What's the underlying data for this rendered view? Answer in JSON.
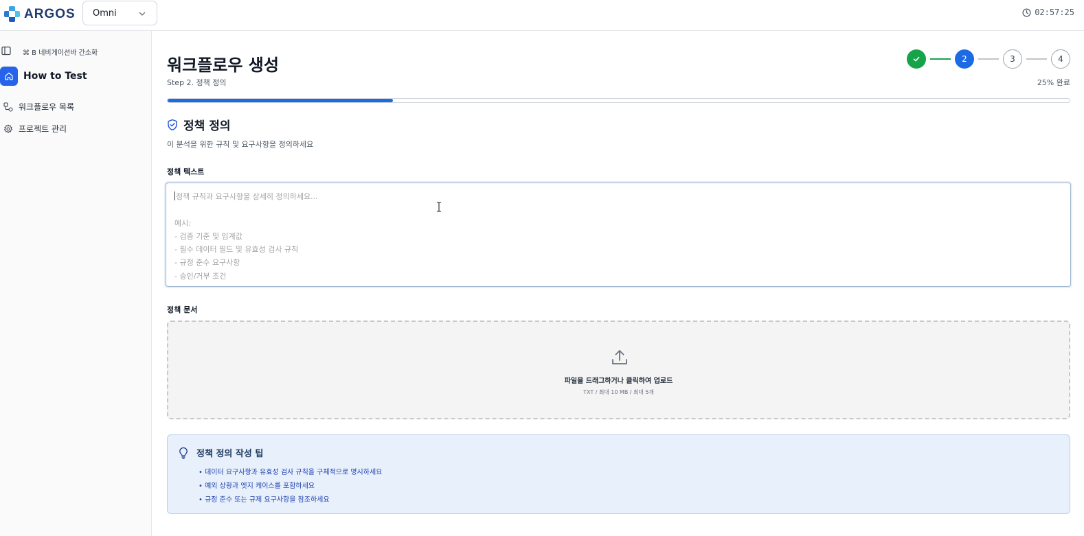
{
  "app": {
    "brand": "ARGOS",
    "project_selected": "Omni",
    "clock": "02:57:25"
  },
  "sidebar": {
    "shortcut_hint": "⌘ B 네비게이션바 간소화",
    "home_label": "How to Test",
    "items": [
      {
        "label": "워크플로우 목록",
        "icon": "workflow-icon"
      },
      {
        "label": "프로젝트 관리",
        "icon": "gear-icon"
      }
    ]
  },
  "page": {
    "title": "워크플로우 생성",
    "step_label": "Step 2. 정책 정의",
    "progress_text": "25% 완료",
    "progress_percent": 25,
    "steps": [
      {
        "label": "",
        "state": "done"
      },
      {
        "label": "2",
        "state": "active"
      },
      {
        "label": "3",
        "state": "todo"
      },
      {
        "label": "4",
        "state": "todo"
      }
    ]
  },
  "section": {
    "title": "정책 정의",
    "subtitle": "이 분석을 위한 규칙 및 요구사항을 정의하세요"
  },
  "policy_text": {
    "label": "정책 텍스트",
    "value": "",
    "placeholder": "정책 규칙과 요구사항을 상세히 정의하세요...\n\n예시:\n- 검증 기준 및 임계값\n- 필수 데이터 필드 및 유효성 검사 규칙\n- 규정 준수 요구사항\n- 승인/거부 조건"
  },
  "policy_docs": {
    "label": "정책 문서",
    "dropzone_title": "파일을 드래그하거나 클릭하여 업로드",
    "dropzone_sub": "TXT / 최대 10 MB / 최대 5개"
  },
  "tips": {
    "title": "정책 정의 작성 팁",
    "items": [
      "데이터 요구사항과 유효성 검사 규칙을 구체적으로 명시하세요",
      "예외 상황과 엣지 케이스를 포함하세요",
      "규정 준수 또는 규제 요구사항을 참조하세요"
    ]
  },
  "colors": {
    "accent": "#1d6ae5",
    "success": "#16a34a",
    "tips_bg": "#e8f0fb"
  }
}
